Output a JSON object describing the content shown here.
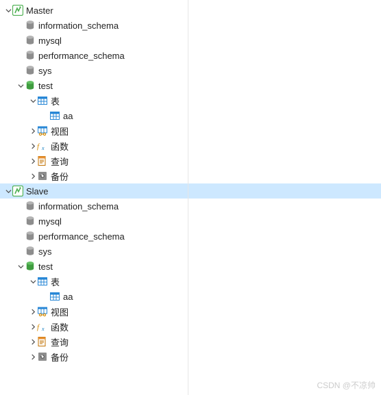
{
  "watermark": "CSDN @不凉帅",
  "tree": [
    {
      "indent": 0,
      "arrow": "down",
      "icon": "connection",
      "label": "Master",
      "selected": false
    },
    {
      "indent": 1,
      "arrow": "none",
      "icon": "db-gray",
      "label": "information_schema",
      "selected": false
    },
    {
      "indent": 1,
      "arrow": "none",
      "icon": "db-gray",
      "label": "mysql",
      "selected": false
    },
    {
      "indent": 1,
      "arrow": "none",
      "icon": "db-gray",
      "label": "performance_schema",
      "selected": false
    },
    {
      "indent": 1,
      "arrow": "none",
      "icon": "db-gray",
      "label": "sys",
      "selected": false
    },
    {
      "indent": 1,
      "arrow": "down",
      "icon": "db-green",
      "label": "test",
      "selected": false
    },
    {
      "indent": 2,
      "arrow": "down",
      "icon": "tables",
      "label": "表",
      "selected": false
    },
    {
      "indent": 3,
      "arrow": "none",
      "icon": "table",
      "label": "aa",
      "selected": false
    },
    {
      "indent": 2,
      "arrow": "right",
      "icon": "views",
      "label": "视图",
      "selected": false
    },
    {
      "indent": 2,
      "arrow": "right",
      "icon": "functions",
      "label": "函数",
      "selected": false
    },
    {
      "indent": 2,
      "arrow": "right",
      "icon": "queries",
      "label": "查询",
      "selected": false
    },
    {
      "indent": 2,
      "arrow": "right",
      "icon": "backups",
      "label": "备份",
      "selected": false
    },
    {
      "indent": 0,
      "arrow": "down",
      "icon": "connection",
      "label": "Slave",
      "selected": true
    },
    {
      "indent": 1,
      "arrow": "none",
      "icon": "db-gray",
      "label": "information_schema",
      "selected": false
    },
    {
      "indent": 1,
      "arrow": "none",
      "icon": "db-gray",
      "label": "mysql",
      "selected": false
    },
    {
      "indent": 1,
      "arrow": "none",
      "icon": "db-gray",
      "label": "performance_schema",
      "selected": false
    },
    {
      "indent": 1,
      "arrow": "none",
      "icon": "db-gray",
      "label": "sys",
      "selected": false
    },
    {
      "indent": 1,
      "arrow": "down",
      "icon": "db-green",
      "label": "test",
      "selected": false
    },
    {
      "indent": 2,
      "arrow": "down",
      "icon": "tables",
      "label": "表",
      "selected": false
    },
    {
      "indent": 3,
      "arrow": "none",
      "icon": "table",
      "label": "aa",
      "selected": false
    },
    {
      "indent": 2,
      "arrow": "right",
      "icon": "views",
      "label": "视图",
      "selected": false
    },
    {
      "indent": 2,
      "arrow": "right",
      "icon": "functions",
      "label": "函数",
      "selected": false
    },
    {
      "indent": 2,
      "arrow": "right",
      "icon": "queries",
      "label": "查询",
      "selected": false
    },
    {
      "indent": 2,
      "arrow": "right",
      "icon": "backups",
      "label": "备份",
      "selected": false
    }
  ]
}
